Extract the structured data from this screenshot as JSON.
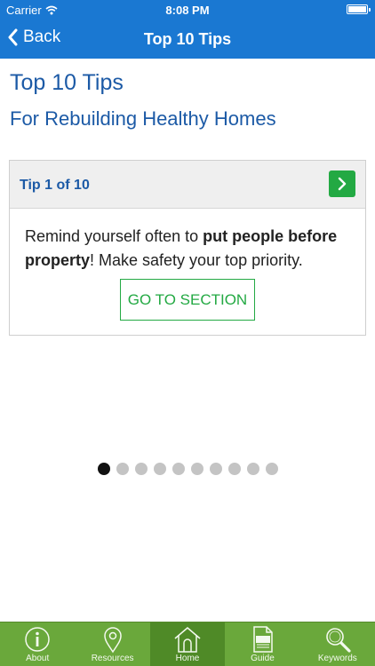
{
  "status_bar": {
    "carrier": "Carrier",
    "time": "8:08 PM"
  },
  "nav": {
    "back_label": "Back",
    "title": "Top 10 Tips"
  },
  "page": {
    "heading": "Top 10 Tips",
    "subheading": "For Rebuilding Healthy Homes"
  },
  "tip_card": {
    "counter": "Tip 1 of 10",
    "text_before": "Remind yourself often to ",
    "text_bold": "put people before property",
    "text_after": "! Make safety your top priority.",
    "button_label": "GO TO SECTION"
  },
  "pager": {
    "total": 10,
    "current": 1
  },
  "tabs": [
    {
      "label": "About",
      "icon": "info-icon"
    },
    {
      "label": "Resources",
      "icon": "map-pin-icon"
    },
    {
      "label": "Home",
      "icon": "home-icon",
      "active": true
    },
    {
      "label": "Guide",
      "icon": "pdf-icon"
    },
    {
      "label": "Keywords",
      "icon": "magnifier-icon"
    }
  ],
  "colors": {
    "nav_blue": "#1a78d2",
    "heading_blue": "#1c5aa6",
    "accent_green": "#23a943",
    "tabbar_green": "#6aa83b"
  }
}
